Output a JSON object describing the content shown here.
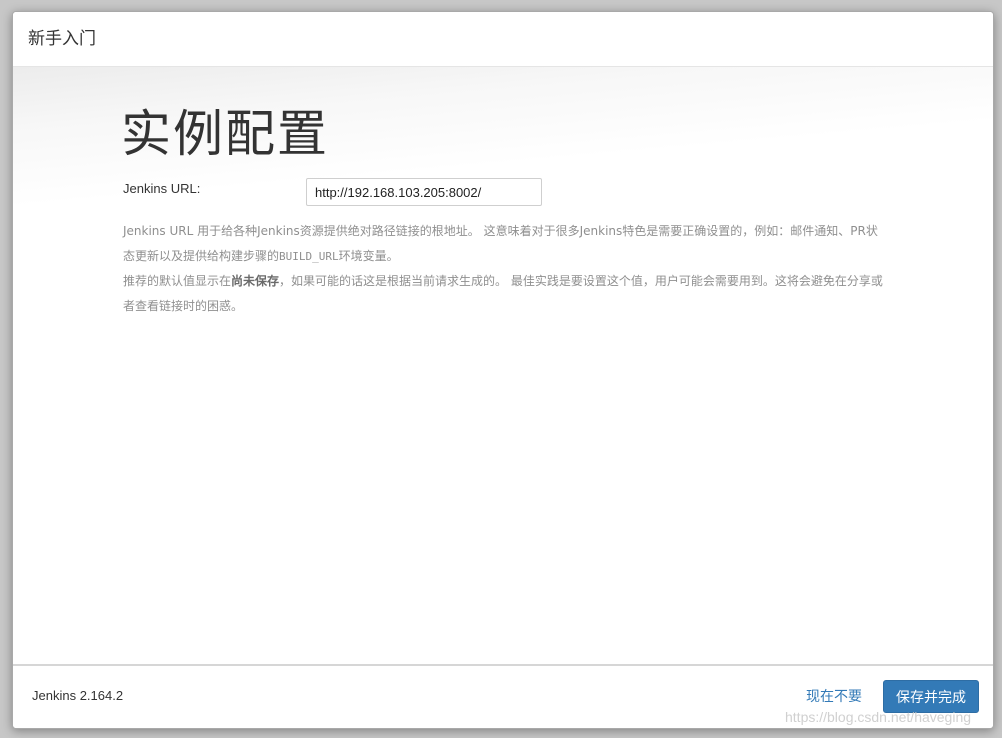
{
  "header": {
    "title": "新手入门"
  },
  "main": {
    "page_title": "实例配置",
    "url_label": "Jenkins URL:",
    "url_value": "http://192.168.103.205:8002/",
    "help_line1_a": "Jenkins URL 用于给各种Jenkins资源提供绝对路径链接的根地址。 这意味着对于很多Jenkins特色是需要正确设置的，例如：邮件通知、PR状态更新以及提供给构建步骤的",
    "help_line1_code": "BUILD_URL",
    "help_line1_b": "环境变量。",
    "help_line2_a": "推荐的默认值显示在",
    "help_line2_bold": "尚未保存",
    "help_line2_b": "，如果可能的话这是根据当前请求生成的。 最佳实践是要设置这个值，用户可能会需要用到。这将会避免在分享或者查看链接时的困惑。"
  },
  "footer": {
    "version": "Jenkins 2.164.2",
    "skip_label": "现在不要",
    "save_label": "保存并完成"
  },
  "watermark": "https://blog.csdn.net/haveging",
  "colors": {
    "primary": "#337ab7",
    "link": "#337ab7",
    "help_text": "#8f8f8f"
  }
}
